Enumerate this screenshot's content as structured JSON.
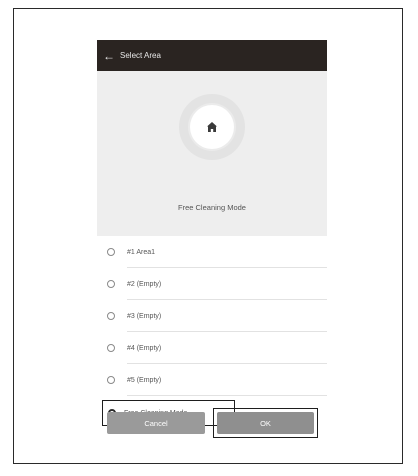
{
  "header": {
    "title": "Select Area",
    "back_icon": "arrow-left-icon"
  },
  "hero": {
    "icon": "home-icon",
    "label": "Free Cleaning Mode"
  },
  "areas": [
    {
      "label": "#1 Area1",
      "selected": false
    },
    {
      "label": "#2 (Empty)",
      "selected": false
    },
    {
      "label": "#3 (Empty)",
      "selected": false
    },
    {
      "label": "#4 (Empty)",
      "selected": false
    },
    {
      "label": "#5 (Empty)",
      "selected": false
    },
    {
      "label": "Free Cleaning Mode",
      "selected": true
    }
  ],
  "buttons": {
    "cancel_label": "Cancel",
    "ok_label": "OK"
  },
  "colors": {
    "titlebar": "#2a2421",
    "hero_bg": "#eeeeee",
    "button_bg": "#9a9a9a"
  }
}
